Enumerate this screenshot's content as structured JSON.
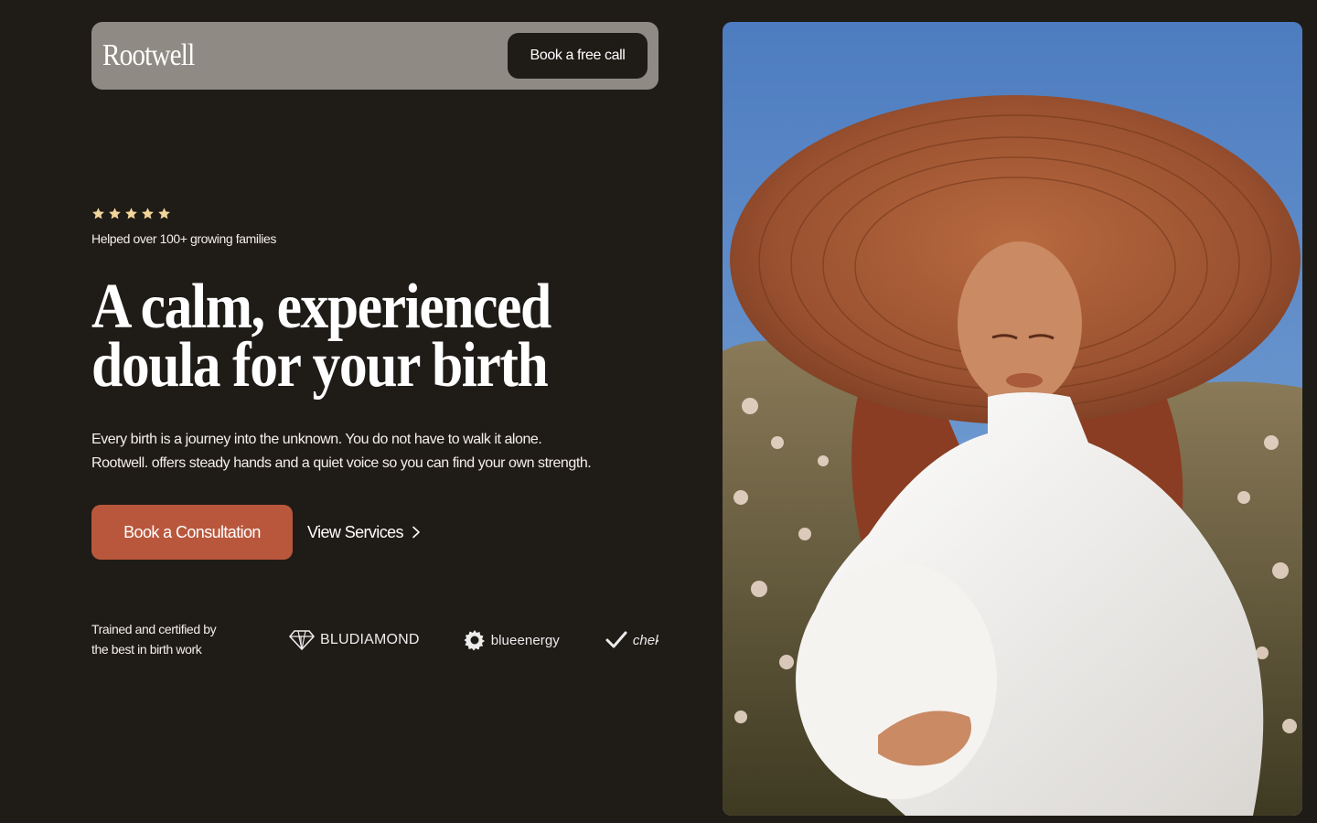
{
  "navbar": {
    "logo": "Rootwell",
    "cta_label": "Book a free call"
  },
  "rating": {
    "stars": 5,
    "star_color": "#f2d59a",
    "text": "Helped over 100+ growing families"
  },
  "hero": {
    "headline_line1": "A calm, experienced",
    "headline_line2": "doula for your birth",
    "subtext_line1": "Every birth is a journey into the unknown. You do not have to walk it alone.",
    "subtext_line2": "Rootwell. offers steady hands and a quiet voice so you can find your own strength.",
    "primary_cta": "Book a Consultation",
    "secondary_cta": "View Services"
  },
  "trust": {
    "line1": "Trained and certified by",
    "line2": "the best in birth work",
    "partners": [
      {
        "name": "BLUDIAMOND",
        "icon": "diamond-icon"
      },
      {
        "name": "blueenergy",
        "icon": "gear-icon"
      },
      {
        "name": "chek",
        "icon": "check-icon"
      }
    ]
  },
  "colors": {
    "background": "#1f1b17",
    "nav_bar": "#8f8b84",
    "accent": "#b9573c",
    "text": "#f4efe8"
  }
}
